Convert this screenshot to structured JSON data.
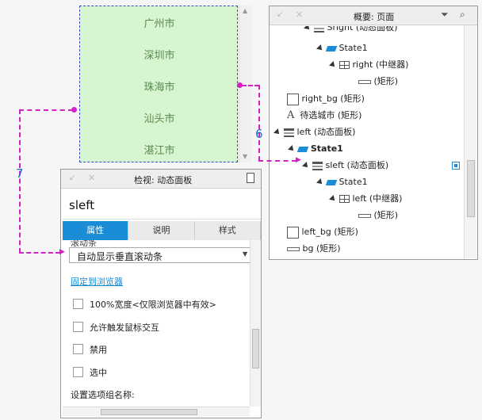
{
  "cities": [
    "广州市",
    "深圳市",
    "珠海市",
    "汕头市",
    "湛江市"
  ],
  "outline": {
    "title": "概要: 页面",
    "rows": [
      {
        "label": "Sright (动态面板)"
      },
      {
        "label": "State1"
      },
      {
        "label": "right (中继器)"
      },
      {
        "label": "(矩形)"
      },
      {
        "label": "right_bg (矩形)"
      },
      {
        "label": "待选城市 (矩形)"
      },
      {
        "label": "left (动态面板)"
      },
      {
        "label": "State1"
      },
      {
        "label": "sleft (动态面板)"
      },
      {
        "label": "State1"
      },
      {
        "label": "left (中继器)"
      },
      {
        "label": "(矩形)"
      },
      {
        "label": "left_bg (矩形)"
      },
      {
        "label": "bg (矩形)"
      }
    ]
  },
  "inspector": {
    "title": "检视: 动态面板",
    "name_value": "sleft",
    "tabs": [
      "属性",
      "说明",
      "样式"
    ],
    "partial_label": "滚动条",
    "scroll_select": "自动显示垂直滚动条",
    "pin_link": "固定到浏览器",
    "checkboxes": [
      "100%宽度<仅限浏览器中有效>",
      "允许触发鼠标交互",
      "禁用",
      "选中"
    ],
    "group_label": "设置选项组名称:"
  },
  "annotations": {
    "six": "6",
    "seven": "7"
  },
  "colors": {
    "accent": "#1a8cd8",
    "connector": "#d321c9",
    "panel_green": "#d7f5d0"
  }
}
